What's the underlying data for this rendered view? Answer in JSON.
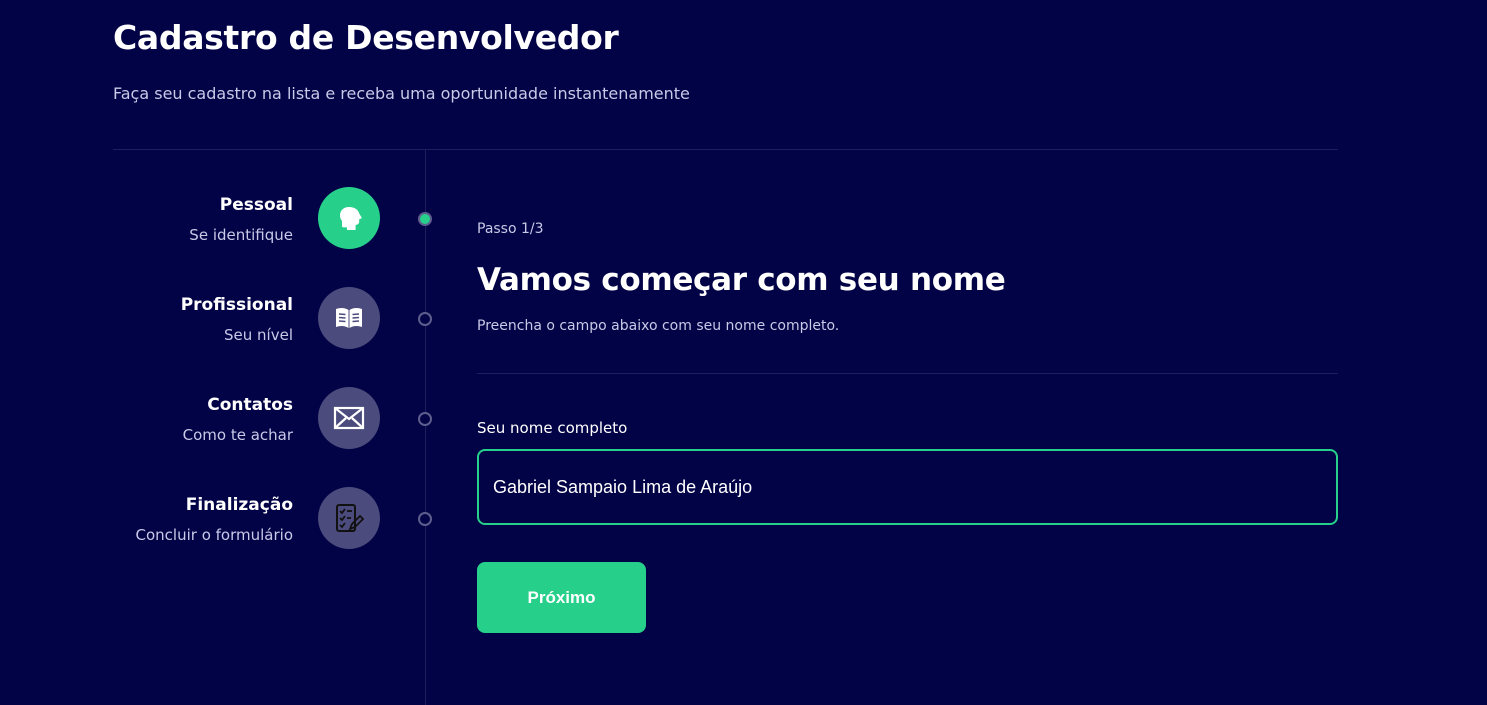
{
  "header": {
    "title": "Cadastro de Desenvolvedor",
    "subtitle": "Faça seu cadastro na lista e receba uma oportunidade instantenamente"
  },
  "steps": [
    {
      "label": "Pessoal",
      "description": "Se identifique",
      "icon": "head-icon",
      "active": true
    },
    {
      "label": "Profissional",
      "description": "Seu nível",
      "icon": "book-icon",
      "active": false
    },
    {
      "label": "Contatos",
      "description": "Como te achar",
      "icon": "mail-icon",
      "active": false
    },
    {
      "label": "Finalização",
      "description": "Concluir o formulário",
      "icon": "checklist-icon",
      "active": false
    }
  ],
  "main": {
    "step_counter": "Passo 1/3",
    "title": "Vamos começar com seu nome",
    "description": "Preencha o campo abaixo com seu nome completo.",
    "field_label": "Seu nome completo",
    "name_value": "Gabriel Sampaio Lima de Araújo",
    "next_label": "Próximo"
  },
  "colors": {
    "background": "#020246",
    "accent": "#26d08a",
    "inactive_circle": "#4b4b7d",
    "muted_text": "#c9c9e8"
  }
}
